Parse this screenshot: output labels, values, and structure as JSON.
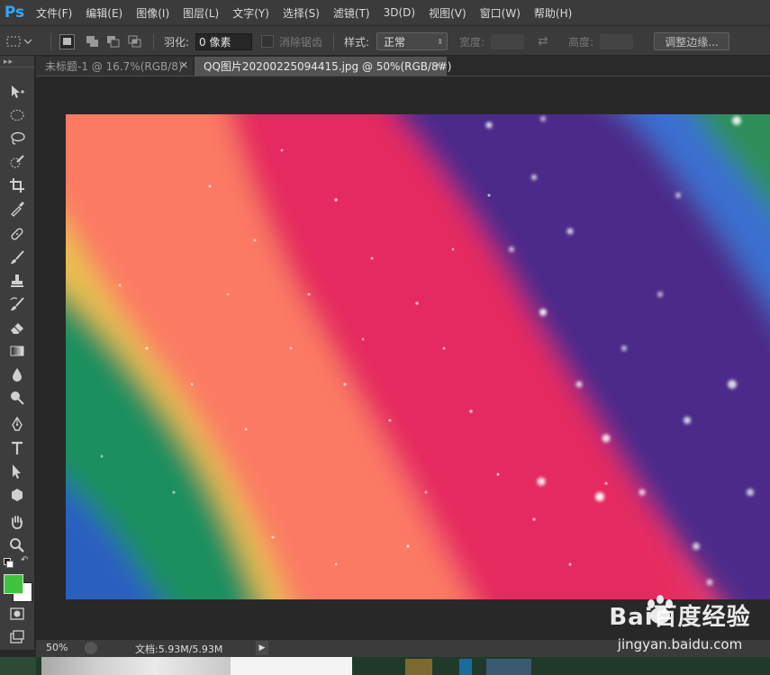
{
  "app": {
    "logo": "Ps",
    "menu": [
      "文件(F)",
      "编辑(E)",
      "图像(I)",
      "图层(L)",
      "文字(Y)",
      "选择(S)",
      "滤镜(T)",
      "3D(D)",
      "视图(V)",
      "窗口(W)",
      "帮助(H)"
    ]
  },
  "options": {
    "feather_label": "羽化:",
    "feather_value": "0 像素",
    "antialias_label": "消除锯齿",
    "style_label": "样式:",
    "style_value": "正常",
    "width_label": "宽度:",
    "height_label": "高度:",
    "refine_edge_button": "调整边缘..."
  },
  "tabs": [
    {
      "label": "未标题-1 @ 16.7%(RGB/8)",
      "active": false
    },
    {
      "label": "QQ图片20200225094415.jpg @ 50%(RGB/8#)",
      "active": true
    }
  ],
  "tools": [
    "move-icon",
    "marquee-icon",
    "lasso-icon",
    "quick-select-icon",
    "crop-icon",
    "eyedropper-icon",
    "healing-brush-icon",
    "brush-icon",
    "clone-stamp-icon",
    "history-brush-icon",
    "eraser-icon",
    "gradient-icon",
    "blur-icon",
    "dodge-icon",
    "pen-icon",
    "type-icon",
    "path-select-icon",
    "shape-icon",
    "hand-icon",
    "zoom-icon"
  ],
  "colors": {
    "foreground": "#3ec43e",
    "background": "#ffffff",
    "accent": "#31a8ff"
  },
  "status": {
    "zoom": "50%",
    "doc_info": "文档:5.93M/5.93M"
  },
  "watermark": {
    "brand": "Bai百度经验",
    "url": "jingyan.baidu.com"
  }
}
